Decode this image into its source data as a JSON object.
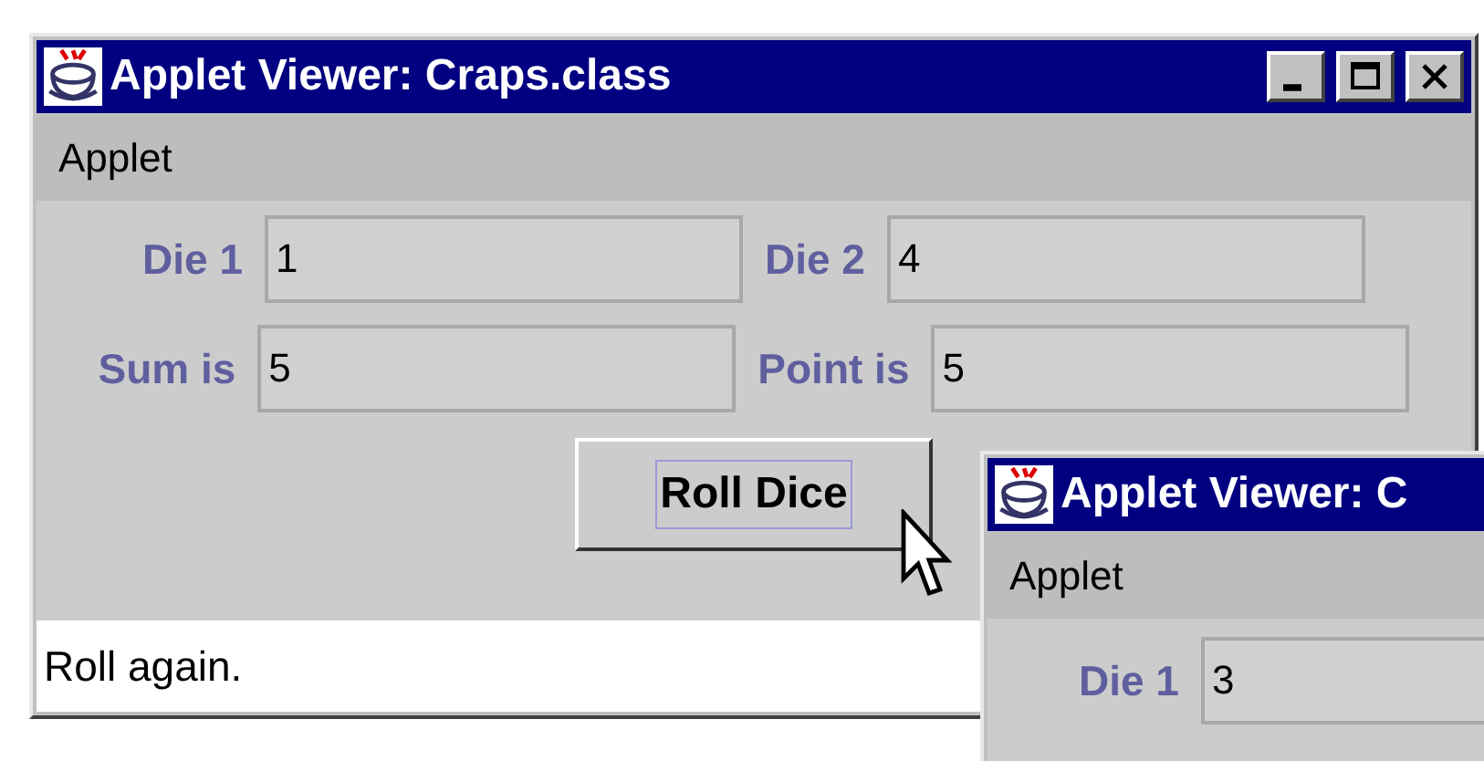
{
  "main_window": {
    "title": "Applet Viewer: Craps.class",
    "menu": [
      "Applet"
    ],
    "rows": [
      [
        {
          "label": "Die 1",
          "value": "1"
        },
        {
          "label": "Die 2",
          "value": "4"
        }
      ],
      [
        {
          "label": "Sum is",
          "value": "5"
        },
        {
          "label": "Point is",
          "value": "5"
        }
      ]
    ],
    "button": "Roll Dice",
    "status": "Roll again."
  },
  "second_window": {
    "title": "Applet Viewer: C",
    "menu": [
      "Applet"
    ],
    "rows": [
      [
        {
          "label": "Die 1",
          "value": "3"
        }
      ]
    ]
  }
}
